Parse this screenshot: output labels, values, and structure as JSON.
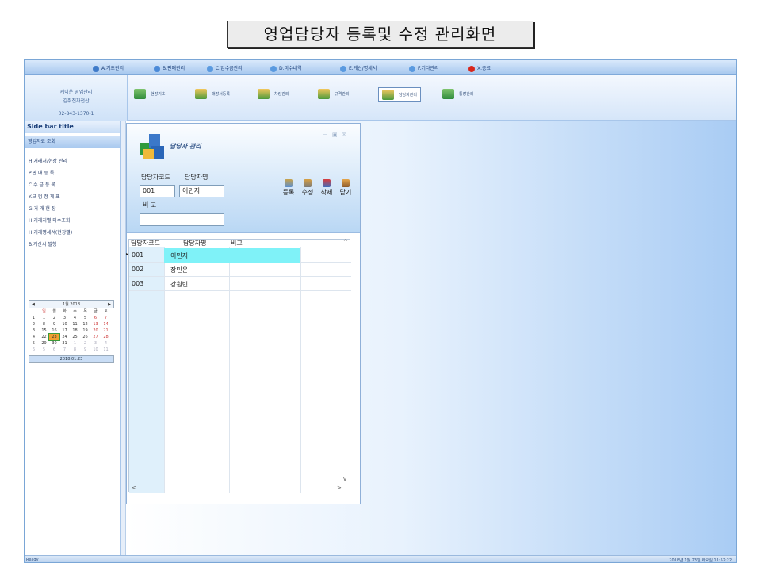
{
  "caption": "영업담당자 등록및 수정 관리화면",
  "menubar": {
    "items": [
      "A.기초관리",
      "B.판매관리",
      "C.입수금관리",
      "D.미수내역",
      "E.계산/명세서",
      "F.기타관리",
      "X.종료"
    ],
    "exit_color": "#d8261c"
  },
  "company": {
    "name": "케이온 영업관리",
    "sub": "김쥐전자전산",
    "phone": "02-843-1370-1"
  },
  "toolbar": {
    "items": [
      "현장기초",
      "매장서등록",
      "차량관리",
      "규격관리",
      "담당자관리",
      "통장관리"
    ]
  },
  "sidebar": {
    "title": "Side bar title",
    "section": "영업자료 조회",
    "items": [
      "H.거래처/현장 관리",
      "P.판 매 등 록",
      "C.수 금 등 록",
      "Y.모 험 정 계 표",
      "G.거 래 현 장",
      "H.거래처별 미수조회",
      "H.거래명세서(현장별)",
      "B.계산서 발행"
    ]
  },
  "calendar": {
    "month": "1월 2018",
    "prev": "◀",
    "next": "▶",
    "weekdays": [
      "",
      "일",
      "월",
      "화",
      "수",
      "목",
      "금",
      "토"
    ],
    "weeks": [
      [
        "1",
        "1",
        "2",
        "3",
        "4",
        "5",
        "6",
        "7"
      ],
      [
        "2",
        "8",
        "9",
        "10",
        "11",
        "12",
        "13",
        "14"
      ],
      [
        "3",
        "15",
        "16",
        "17",
        "18",
        "19",
        "20",
        "21"
      ],
      [
        "4",
        "22",
        "23",
        "24",
        "25",
        "26",
        "27",
        "28"
      ],
      [
        "5",
        "29",
        "30",
        "31",
        "1",
        "2",
        "3",
        "4"
      ],
      [
        "6",
        "5",
        "6",
        "7",
        "8",
        "9",
        "10",
        "11"
      ]
    ],
    "selected": "2018.01.23"
  },
  "dialog": {
    "title": "담당자 관리",
    "code_label": "담당자코드",
    "name_label": "담당자명",
    "code_value": "001",
    "name_value": "이민지",
    "note_label": "비  고",
    "note_value": "",
    "buttons": {
      "register": "등록",
      "edit": "수정",
      "delete": "삭제",
      "close": "닫기"
    },
    "win_min": "▭",
    "win_max": "▣",
    "win_close": "☒"
  },
  "grid": {
    "columns": [
      "담당자코드",
      "담당자명",
      "비고"
    ],
    "rows": [
      {
        "code": "001",
        "name": "이민지",
        "note": ""
      },
      {
        "code": "002",
        "name": "장민은",
        "note": ""
      },
      {
        "code": "003",
        "name": "강원빈",
        "note": ""
      }
    ],
    "row_indicator": "▸",
    "scroll_left": "<",
    "scroll_right": ">",
    "scroll_up": "^",
    "scroll_down": "v"
  },
  "status": {
    "left": "Ready",
    "right": "2018년 1월 23일 화요일 11:52:22"
  }
}
